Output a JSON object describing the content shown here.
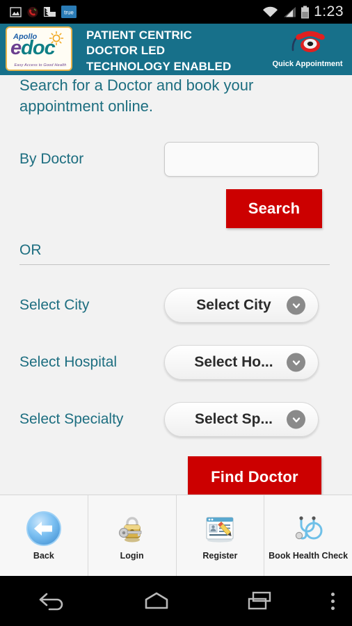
{
  "status_bar": {
    "time": "1:23",
    "left_icons": [
      "gallery-icon",
      "missed-call-icon",
      "signal-alt-icon",
      "true-app-icon"
    ],
    "true_badge_label": "true",
    "right_icons": [
      "wifi-icon",
      "cellular-signal-icon",
      "battery-icon"
    ]
  },
  "header": {
    "logo": {
      "apollo": "Apollo",
      "e": "e",
      "doc": "doc",
      "tagline": "Easy Access to Good Health"
    },
    "tagline_lines": [
      "PATIENT CENTRIC",
      "DOCTOR LED",
      "TECHNOLOGY ENABLED"
    ],
    "quick_appointment": {
      "label": "Quick Appointment",
      "icon": "telephone-icon"
    },
    "background_color": "#17708a"
  },
  "main": {
    "intro_text": "Search for a Doctor and book your appointment online.",
    "doctor_search": {
      "label": "By Doctor",
      "value": "",
      "placeholder": ""
    },
    "search_button": "Search",
    "or_text": "OR",
    "selects": [
      {
        "label": "Select City",
        "value": "Select City",
        "icon": "chevron-down-icon"
      },
      {
        "label": "Select Hospital",
        "value": "Select Ho...",
        "icon": "chevron-down-icon"
      },
      {
        "label": "Select Specialty",
        "value": "Select Sp...",
        "icon": "chevron-down-icon"
      }
    ],
    "find_doctor_button": "Find Doctor",
    "accent_color": "#cc0000",
    "label_color": "#1d6e80"
  },
  "toolbar": {
    "items": [
      {
        "label": "Back",
        "icon": "back-arrow-icon"
      },
      {
        "label": "Login",
        "icon": "padlock-key-icon"
      },
      {
        "label": "Register",
        "icon": "registration-form-icon"
      },
      {
        "label": "Book Health Check",
        "icon": "stethoscope-icon"
      }
    ]
  },
  "nav_bar": {
    "buttons": [
      "back-nav-icon",
      "home-nav-icon",
      "recents-nav-icon",
      "overflow-menu-icon"
    ]
  }
}
